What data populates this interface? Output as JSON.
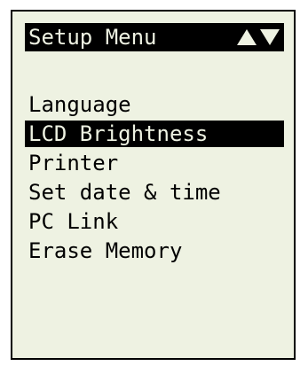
{
  "header": {
    "title": "Setup Menu",
    "scroll_up_icon": "triangle-up-icon",
    "scroll_down_icon": "triangle-down-icon"
  },
  "menu": {
    "selected_index": 1,
    "items": [
      {
        "label": "Language"
      },
      {
        "label": "LCD Brightness"
      },
      {
        "label": "Printer"
      },
      {
        "label": "Set date & time"
      },
      {
        "label": "PC Link"
      },
      {
        "label": "Erase Memory"
      }
    ]
  },
  "colors": {
    "screen_background": "#eef2e2",
    "foreground": "#000000",
    "highlight_background": "#000000",
    "highlight_text": "#eef2e2"
  }
}
